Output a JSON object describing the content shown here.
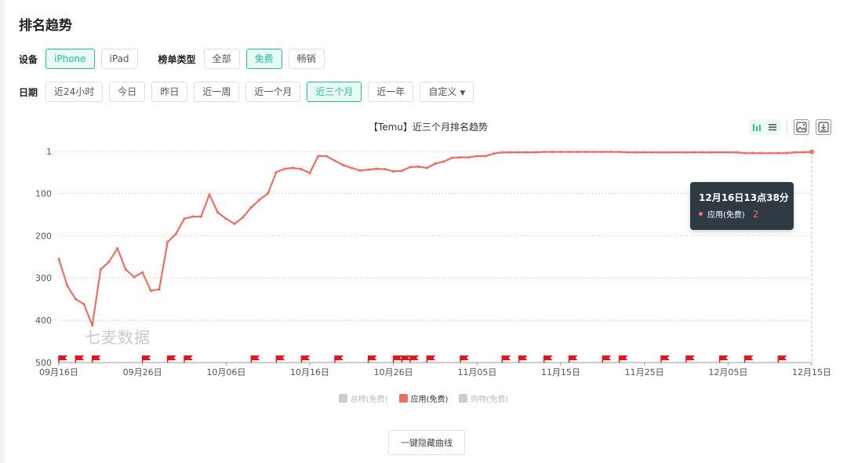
{
  "page": {
    "title": "排名趋势"
  },
  "filters": {
    "device_label": "设备",
    "devices": [
      "iPhone",
      "iPad"
    ],
    "device_selected": 0,
    "chart_type_label": "榜单类型",
    "chart_types": [
      "全部",
      "免费",
      "畅销"
    ],
    "chart_type_selected": 1,
    "date_label": "日期",
    "dates": [
      "近24小时",
      "今日",
      "昨日",
      "近一周",
      "近一个月",
      "近三个月",
      "近一年"
    ],
    "date_selected": 5,
    "custom_label": "自定义"
  },
  "toolbar_icons": [
    "bar-chart-icon",
    "list-icon",
    "image-icon",
    "download-icon"
  ],
  "watermark": "七麦数据",
  "tooltip": {
    "title": "12月16日13点38分",
    "series": "应用(免费)",
    "value": "2"
  },
  "legend": [
    {
      "name": "总榜(免费)",
      "active": false
    },
    {
      "name": "应用(免费)",
      "active": true
    },
    {
      "name": "购物(免费)",
      "active": false
    }
  ],
  "hide_button": "一键隐藏曲线",
  "colors": {
    "accent": "#20c29a",
    "line": "#ee6f60",
    "flag": "#e8141b",
    "grid": "#d8d8d8"
  },
  "chart_data": {
    "type": "line",
    "title": "【Temu】近三个月排名趋势",
    "y_reversed": true,
    "ylim": [
      1,
      500
    ],
    "y_ticks": [
      "1",
      "100",
      "200",
      "300",
      "400",
      "500"
    ],
    "x_ticks": [
      "09月16日",
      "09月26日",
      "10月06日",
      "10月16日",
      "10月26日",
      "11月05日",
      "11月15日",
      "11月25日",
      "12月05日",
      "12月15日"
    ],
    "series": [
      {
        "name": "应用(免费)",
        "values": [
          255,
          318,
          350,
          362,
          412,
          280,
          262,
          230,
          280,
          298,
          287,
          330,
          327,
          215,
          196,
          160,
          155,
          155,
          103,
          145,
          160,
          172,
          157,
          133,
          115,
          100,
          50,
          42,
          40,
          43,
          52,
          12,
          12,
          23,
          33,
          40,
          46,
          44,
          42,
          43,
          48,
          47,
          38,
          37,
          40,
          30,
          25,
          16,
          15,
          15,
          12,
          12,
          6,
          3,
          3,
          3,
          3,
          3,
          2,
          2,
          2,
          2,
          2,
          2,
          2,
          2,
          2,
          2,
          3,
          3,
          3,
          3,
          3,
          3,
          3,
          3,
          3,
          3,
          3,
          3,
          3,
          3,
          5,
          5,
          5,
          5,
          5,
          5,
          3,
          3,
          2
        ]
      }
    ],
    "event_flag_days": [
      0,
      2,
      4,
      10,
      13,
      15,
      23,
      26,
      29,
      33,
      37,
      40,
      41,
      42,
      44,
      48,
      53,
      55,
      58,
      61,
      65,
      67,
      72,
      75,
      79,
      82,
      86
    ]
  }
}
